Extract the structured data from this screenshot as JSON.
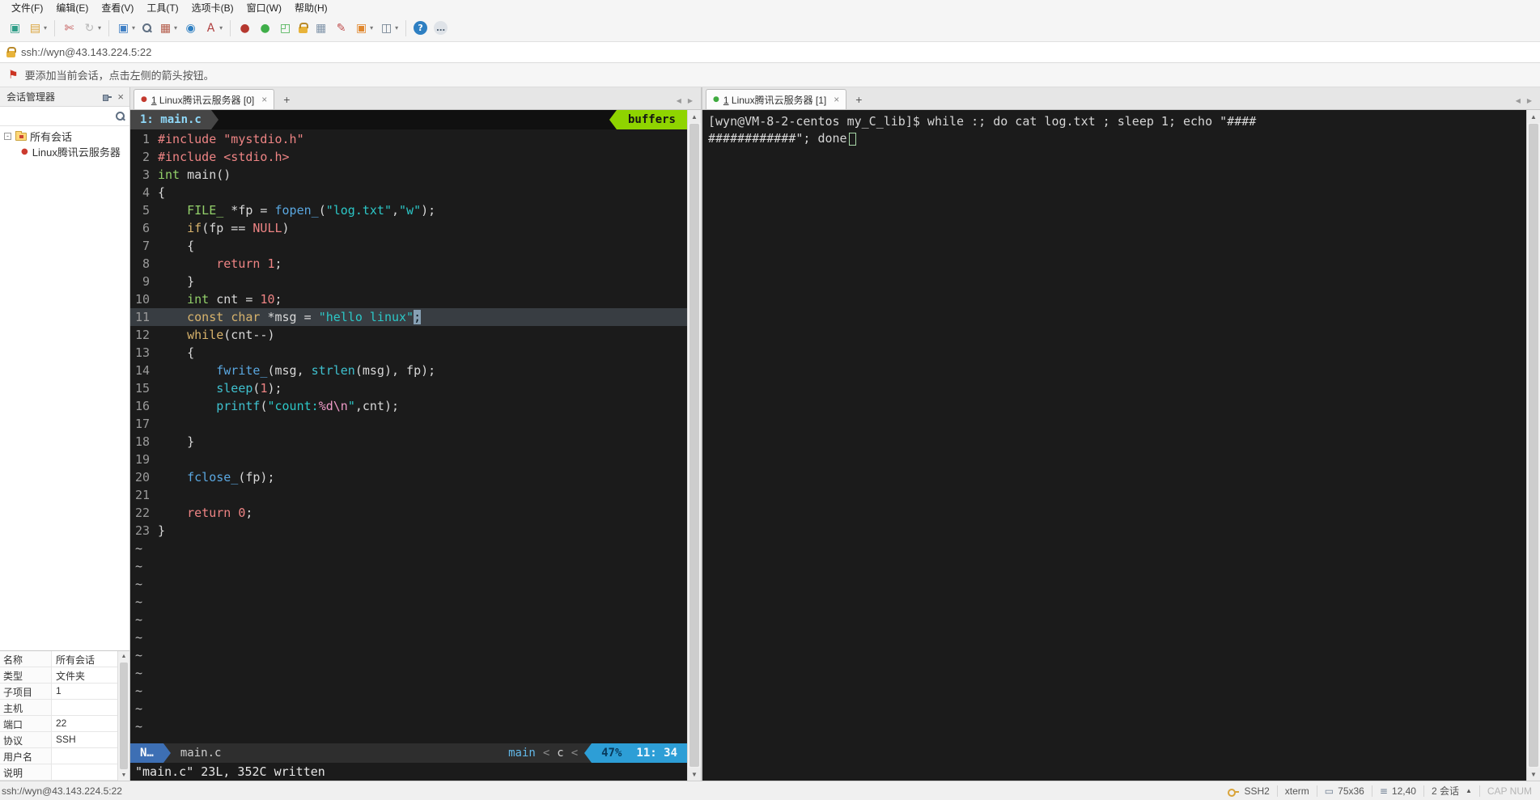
{
  "icons": {
    "close": "×",
    "plus": "+",
    "prev": "◀",
    "next": "▶",
    "up": "▲",
    "down": "▼",
    "flag": "⚑",
    "session_dot": "●",
    "tree_expander": "-",
    "dropdown": "▾",
    "term_size": "▭",
    "cursor_pos": "≡"
  },
  "menubar": {
    "items": [
      {
        "id": "file",
        "label": "文件(F)"
      },
      {
        "id": "edit",
        "label": "编辑(E)"
      },
      {
        "id": "view",
        "label": "查看(V)"
      },
      {
        "id": "tools",
        "label": "工具(T)"
      },
      {
        "id": "tab",
        "label": "选项卡(B)"
      },
      {
        "id": "window",
        "label": "窗口(W)"
      },
      {
        "id": "help",
        "label": "帮助(H)"
      }
    ]
  },
  "toolbar": {
    "buttons": [
      {
        "name": "new-session-icon",
        "glyph": "▣",
        "color": "#2f9e88",
        "drop": false,
        "sep_after": false
      },
      {
        "name": "open-session-folder-icon",
        "glyph": "▤",
        "color": "#d9a43a",
        "drop": true,
        "sep_after": true
      },
      {
        "name": "disconnect-icon",
        "glyph": "✄",
        "color": "#c05050",
        "drop": false,
        "sep_after": false
      },
      {
        "name": "reconnect-icon",
        "glyph": "↻",
        "color": "#b8b8b8",
        "drop": true,
        "sep_after": true
      },
      {
        "name": "file-transfer-icon",
        "glyph": "▣",
        "color": "#3f7fc4",
        "drop": true,
        "sep_after": false
      },
      {
        "name": "find-icon",
        "css": "mag",
        "drop": false,
        "sep_after": false
      },
      {
        "name": "properties-icon",
        "glyph": "▦",
        "color": "#b35a48",
        "drop": true,
        "sep_after": false
      },
      {
        "name": "web-browser-icon",
        "glyph": "◉",
        "color": "#2e7fc2",
        "drop": false,
        "sep_after": false
      },
      {
        "name": "font-color-icon",
        "glyph": "A",
        "color": "#b04040",
        "drop": true,
        "sep_after": true
      },
      {
        "name": "record-icon",
        "glyph": "●",
        "color": "#b5382f",
        "drop": false,
        "sep_after": false
      },
      {
        "name": "capture-icon",
        "glyph": "●",
        "color": "#3fae49",
        "drop": false,
        "sep_after": false
      },
      {
        "name": "fullscreen-icon",
        "glyph": "◰",
        "color": "#3fae49",
        "drop": false,
        "sep_after": false
      },
      {
        "name": "lock-screen-icon",
        "css": "lockicon",
        "drop": false,
        "sep_after": false
      },
      {
        "name": "virtual-keypad-icon",
        "glyph": "▦",
        "color": "#7f93a8",
        "drop": false,
        "sep_after": false
      },
      {
        "name": "compose-icon",
        "glyph": "✎",
        "color": "#c05050",
        "drop": false,
        "sep_after": false
      },
      {
        "name": "new-file-icon",
        "glyph": "▣",
        "color": "#e0872e",
        "drop": true,
        "sep_after": false
      },
      {
        "name": "tile-windows-icon",
        "glyph": "◫",
        "color": "#667788",
        "drop": true,
        "sep_after": true
      },
      {
        "name": "help-icon",
        "glyph": "?",
        "color": "#ffffff",
        "bg": "#2e7fc2",
        "drop": false,
        "sep_after": false
      },
      {
        "name": "feedback-icon",
        "glyph": "…",
        "color": "#556677",
        "bg": "#dfe3e8",
        "drop": false,
        "sep_after": false
      }
    ]
  },
  "addressbar": {
    "url": "ssh://wyn@43.143.224.5:22"
  },
  "noticebar": {
    "text": "要添加当前会话，点击左侧的箭头按钮。"
  },
  "sidebar": {
    "title": "会话管理器",
    "tree": {
      "root": "所有会话",
      "sessions": [
        {
          "name": "Linux腾讯云服务器"
        }
      ]
    },
    "properties": {
      "rows": [
        [
          "名称",
          "所有会话"
        ],
        [
          "类型",
          "文件夹"
        ],
        [
          "子项目",
          "1"
        ],
        [
          "主机",
          ""
        ],
        [
          "端口",
          "22"
        ],
        [
          "协议",
          "SSH"
        ],
        [
          "用户名",
          ""
        ],
        [
          "说明",
          ""
        ]
      ]
    }
  },
  "left_pane": {
    "tab": {
      "index": "1",
      "label": "Linux腾讯云服务器 [0]"
    },
    "vim": {
      "tabline": {
        "buffer": "1: main.c",
        "right_label": "buffers"
      },
      "current_line": 11,
      "tilde_count": 11,
      "code_lines": [
        [
          [
            "pre",
            "#include"
          ],
          [
            "p",
            " "
          ],
          [
            "pstr",
            "\"mystdio.h\""
          ]
        ],
        [
          [
            "pre",
            "#include"
          ],
          [
            "p",
            " "
          ],
          [
            "pstr",
            "<stdio.h>"
          ]
        ],
        [
          [
            "typ",
            "int"
          ],
          [
            "p",
            " main()"
          ]
        ],
        [
          [
            "p",
            "{"
          ]
        ],
        [
          [
            "p",
            "    "
          ],
          [
            "typ",
            "FILE_"
          ],
          [
            "p",
            " *fp = "
          ],
          [
            "fn",
            "fopen_"
          ],
          [
            "p",
            "("
          ],
          [
            "str",
            "\"log.txt\""
          ],
          [
            "p",
            ","
          ],
          [
            "str",
            "\"w\""
          ],
          [
            "p",
            ");"
          ]
        ],
        [
          [
            "p",
            "    "
          ],
          [
            "kw",
            "if"
          ],
          [
            "p",
            "(fp == "
          ],
          [
            "cst",
            "NULL"
          ],
          [
            "p",
            ")"
          ]
        ],
        [
          [
            "p",
            "    {"
          ]
        ],
        [
          [
            "p",
            "        "
          ],
          [
            "ret",
            "return"
          ],
          [
            "p",
            " "
          ],
          [
            "cst",
            "1"
          ],
          [
            "p",
            ";"
          ]
        ],
        [
          [
            "p",
            "    }"
          ]
        ],
        [
          [
            "p",
            "    "
          ],
          [
            "typ",
            "int"
          ],
          [
            "p",
            " cnt = "
          ],
          [
            "cst",
            "10"
          ],
          [
            "p",
            ";"
          ]
        ],
        [
          [
            "p",
            "    "
          ],
          [
            "kw",
            "const"
          ],
          [
            "p",
            " "
          ],
          [
            "kw",
            "char"
          ],
          [
            "p",
            " *msg = "
          ],
          [
            "str",
            "\"hello linux\""
          ],
          [
            "cur",
            ";"
          ]
        ],
        [
          [
            "p",
            "    "
          ],
          [
            "kw",
            "while"
          ],
          [
            "p",
            "(cnt--)"
          ]
        ],
        [
          [
            "p",
            "    {"
          ]
        ],
        [
          [
            "p",
            "        "
          ],
          [
            "fn",
            "fwrite_"
          ],
          [
            "p",
            "(msg, "
          ],
          [
            "fn2",
            "strlen"
          ],
          [
            "p",
            "(msg), fp);"
          ]
        ],
        [
          [
            "p",
            "        "
          ],
          [
            "fn2",
            "sleep"
          ],
          [
            "p",
            "("
          ],
          [
            "cst",
            "1"
          ],
          [
            "p",
            ");"
          ]
        ],
        [
          [
            "p",
            "        "
          ],
          [
            "fn2",
            "printf"
          ],
          [
            "p",
            "("
          ],
          [
            "str",
            "\"count:"
          ],
          [
            "spc",
            "%d\\n"
          ],
          [
            "str",
            "\""
          ],
          [
            "p",
            ",cnt);"
          ]
        ],
        [],
        [
          [
            "p",
            "    }"
          ]
        ],
        [],
        [
          [
            "p",
            "    "
          ],
          [
            "fn",
            "fclose_"
          ],
          [
            "p",
            "(fp);"
          ]
        ],
        [],
        [
          [
            "p",
            "    "
          ],
          [
            "ret",
            "return"
          ],
          [
            "p",
            " "
          ],
          [
            "cst",
            "0"
          ],
          [
            "p",
            ";"
          ]
        ],
        [
          [
            "p",
            "}"
          ]
        ]
      ],
      "statusline": {
        "mode": "N…",
        "file": "main.c",
        "branch": "main",
        "sep": "<",
        "filetype": "c",
        "percent": "47%",
        "position": "11: 34"
      },
      "message": "\"main.c\" 23L, 352C written"
    }
  },
  "right_pane": {
    "tab": {
      "index": "1",
      "label": "Linux腾讯云服务器 [1]"
    },
    "shell": {
      "lines": [
        "[wyn@VM-8-2-centos my_C_lib]$ while :; do cat log.txt ; sleep 1; echo \"####",
        "############\"; done"
      ]
    }
  },
  "statusbar": {
    "url": "ssh://wyn@43.143.224.5:22",
    "protocol": "SSH2",
    "term_type": "xterm",
    "size": "75x36",
    "cursor": "12,40",
    "sessions": "2 会话",
    "locks": "CAP NUM"
  }
}
